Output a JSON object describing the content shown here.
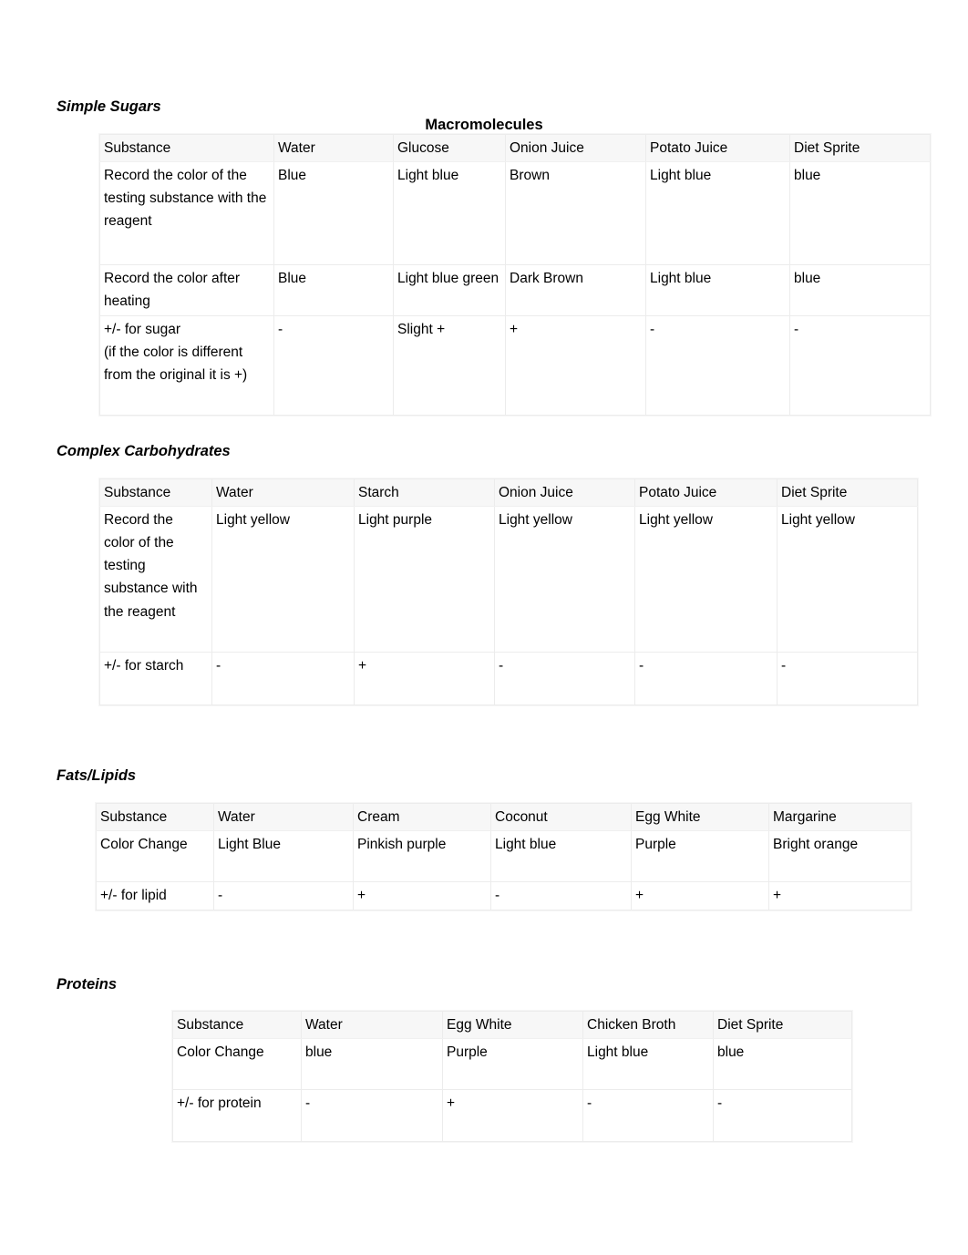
{
  "document": {
    "title": "Macromolecules"
  },
  "sections": [
    {
      "heading": "Simple Sugars",
      "table": {
        "header": [
          "Substance",
          "Water",
          "Glucose",
          "Onion Juice",
          "Potato Juice",
          "Diet Sprite"
        ],
        "rows": [
          {
            "label": "Record the color of the testing substance with the reagent",
            "cells": [
              "Blue",
              "Light blue",
              "Brown",
              "Light blue",
              "blue"
            ]
          },
          {
            "label": "Record the color after heating",
            "cells": [
              "Blue",
              "Light blue green",
              "Dark Brown",
              "Light blue",
              "blue"
            ]
          },
          {
            "label": "+/- for sugar\n(if the color is different from the original it is +)",
            "cells": [
              "-",
              "Slight +",
              "+",
              "-",
              "-"
            ]
          }
        ]
      }
    },
    {
      "heading": "Complex Carbohydrates",
      "table": {
        "header": [
          "Substance",
          "Water",
          "Starch",
          "Onion Juice",
          "Potato Juice",
          "Diet Sprite"
        ],
        "rows": [
          {
            "label": "Record the color of the testing substance with the reagent",
            "cells": [
              "Light yellow",
              "Light purple",
              "Light yellow",
              "Light yellow",
              "Light yellow"
            ]
          },
          {
            "label": "+/- for starch",
            "cells": [
              "-",
              "+",
              "-",
              "-",
              "-"
            ]
          }
        ]
      }
    },
    {
      "heading": "Fats/Lipids",
      "table": {
        "header": [
          "Substance",
          "Water",
          "Cream",
          "Coconut",
          "Egg White",
          "Margarine"
        ],
        "rows": [
          {
            "label": "Color Change",
            "cells": [
              "Light Blue",
              "Pinkish purple",
              "Light blue",
              "Purple",
              "Bright orange"
            ]
          },
          {
            "label": "+/- for lipid",
            "cells": [
              "-",
              "+",
              "-",
              "+",
              "+"
            ]
          }
        ]
      }
    },
    {
      "heading": "Proteins",
      "table": {
        "header": [
          "Substance",
          "Water",
          "Egg White",
          "Chicken Broth",
          "Diet Sprite"
        ],
        "rows": [
          {
            "label": "Color Change",
            "cells": [
              "blue",
              "Purple",
              "Light blue",
              "blue"
            ]
          },
          {
            "label": "+/- for protein",
            "cells": [
              "-",
              "+",
              "-",
              "-"
            ]
          }
        ]
      }
    }
  ]
}
